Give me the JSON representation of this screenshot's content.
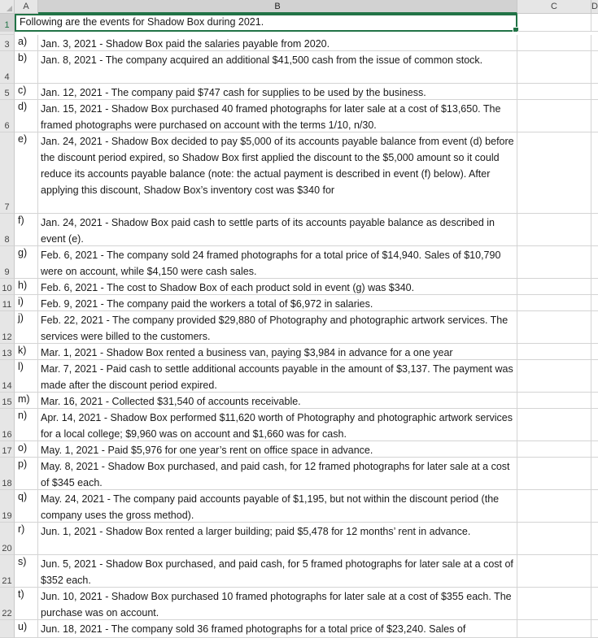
{
  "columns": [
    "A",
    "B",
    "C",
    "D"
  ],
  "title_row": {
    "num": "1",
    "text": "Following are the events for Shadow Box during 2021."
  },
  "rows": [
    {
      "num": "3",
      "label": "a)",
      "text": "Jan. 3, 2021 - Shadow Box paid the salaries payable from 2020."
    },
    {
      "num": "4",
      "label": "b)",
      "text": "Jan. 8, 2021 - The company acquired an additional $41,500 cash from the issue of common stock."
    },
    {
      "num": "5",
      "label": "c)",
      "text": "Jan. 12, 2021 - The company paid $747 cash for supplies to be used by the business."
    },
    {
      "num": "6",
      "label": "d)",
      "text": "Jan. 15, 2021 - Shadow Box purchased 40 framed photographs for later sale at a cost of $13,650. The framed photographs were purchased on account with the terms 1/10, n/30."
    },
    {
      "num": "7",
      "label": "e)",
      "text": "Jan. 24, 2021 - Shadow Box decided to pay $5,000 of its accounts payable balance from event (d) before the discount period expired, so Shadow Box first applied the discount to the $5,000 amount so it could reduce its accounts payable balance (note: the actual payment is described in event (f) below). After applying this discount, Shadow Box’s inventory cost was $340 for"
    },
    {
      "num": "8",
      "label": "f)",
      "text": "Jan. 24, 2021 - Shadow Box paid cash to settle parts of its accounts payable balance as described in event (e)."
    },
    {
      "num": "9",
      "label": "g)",
      "text": "Feb. 6, 2021 - The company sold 24 framed photographs for a total price of $14,940. Sales of $10,790 were on account, while $4,150 were cash sales."
    },
    {
      "num": "10",
      "label": "h)",
      "text": "Feb. 6, 2021 - The cost to Shadow Box of each product sold in event (g) was $340."
    },
    {
      "num": "11",
      "label": "i)",
      "text": "Feb. 9, 2021 - The company paid the workers a total of $6,972 in salaries."
    },
    {
      "num": "12",
      "label": "j)",
      "text": "Feb. 22, 2021 - The company provided $29,880 of Photography and photographic artwork services. The services were billed to the customers."
    },
    {
      "num": "13",
      "label": "k)",
      "text": "Mar. 1, 2021 - Shadow Box rented a business van, paying $3,984 in advance for a one year"
    },
    {
      "num": "14",
      "label": "l)",
      "text": "Mar. 7, 2021 - Paid cash to settle additional accounts payable in the amount of $3,137. The payment was made after the discount period expired."
    },
    {
      "num": "15",
      "label": "m)",
      "text": "Mar. 16, 2021 - Collected $31,540 of accounts receivable."
    },
    {
      "num": "16",
      "label": "n)",
      "text": "Apr. 14, 2021 - Shadow Box performed $11,620 worth of Photography and photographic artwork services for a local college; $9,960 was on account and $1,660 was for cash."
    },
    {
      "num": "17",
      "label": "o)",
      "text": "May. 1, 2021 - Paid $5,976 for one year’s rent on office space in advance."
    },
    {
      "num": "18",
      "label": "p)",
      "text": "May. 8, 2021 - Shadow Box purchased, and paid cash, for 12 framed photographs for later sale at a cost of $345 each."
    },
    {
      "num": "19",
      "label": "q)",
      "text": "May. 24, 2021 - The company paid accounts payable of $1,195, but not within the discount period (the company uses the gross method)."
    },
    {
      "num": "20",
      "label": "r)",
      "text": "Jun. 1, 2021 - Shadow Box rented a larger building; paid $5,478 for 12 months’ rent in advance."
    },
    {
      "num": "21",
      "label": "s)",
      "text": "Jun. 5, 2021 - Shadow Box purchased, and paid cash, for 5 framed photographs for later sale at a cost of $352 each."
    },
    {
      "num": "22",
      "label": "t)",
      "text": "Jun. 10, 2021 - Shadow Box purchased 10 framed photographs for later sale at a cost of $355 each. The purchase was on account."
    },
    {
      "num": "",
      "label": "u)",
      "text": "Jun. 18, 2021 - The company sold 36 framed photographs for a total price of $23,240. Sales of"
    }
  ],
  "colors": {
    "accent": "#217346",
    "header_bg": "#e6e6e6",
    "gridline": "#d4d4d4"
  }
}
